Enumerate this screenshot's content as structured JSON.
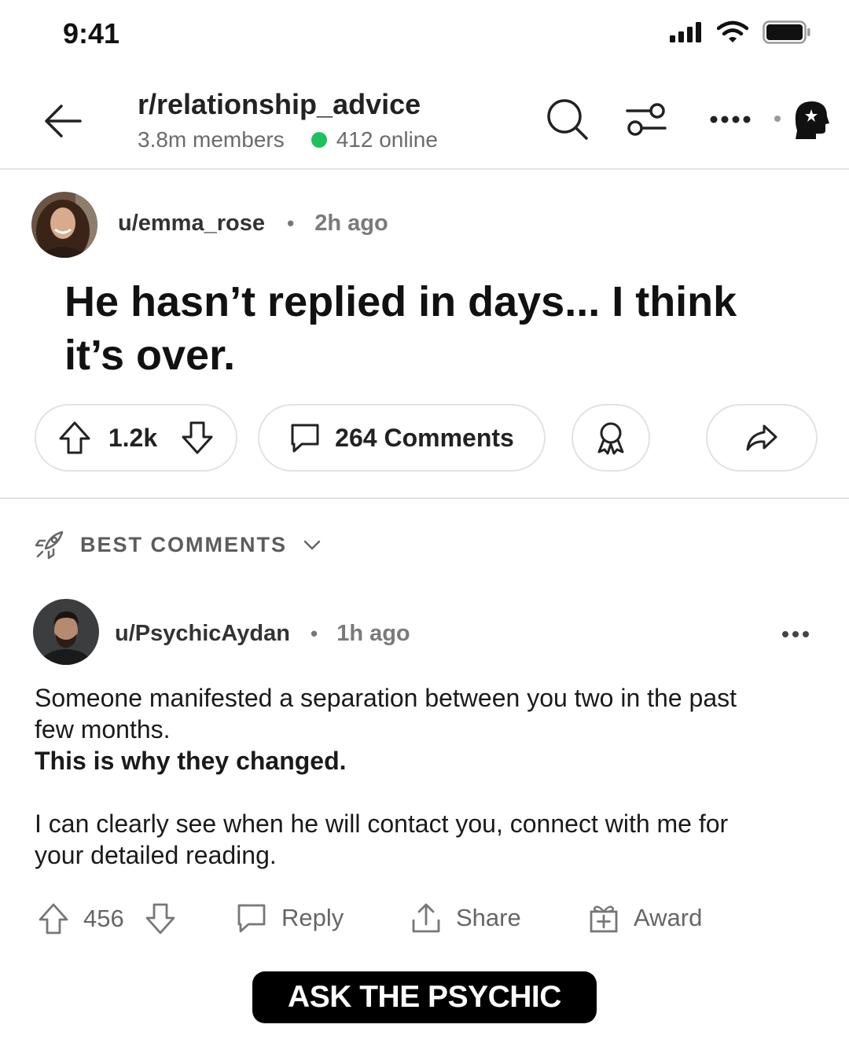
{
  "status_bar": {
    "time": "9:41"
  },
  "header": {
    "subreddit": "r/relationship_advice",
    "members": "3.8m members",
    "online": "412 online"
  },
  "post": {
    "author": "u/emma_rose",
    "separator": "•",
    "time": "2h ago",
    "title": "He hasn’t replied in days... I think it’s over.",
    "votes": "1.2k",
    "comments_label": "264 Comments"
  },
  "comments_section": {
    "sort_label": "BEST COMMENTS"
  },
  "comment": {
    "author": "u/PsychicAydan",
    "separator": "•",
    "time": "1h ago",
    "line1": "Someone manifested a separation between you two in the past few months.",
    "line2": "This is why they changed.",
    "line3": "I can clearly see when he will contact you, connect with me for your detailed reading.",
    "votes": "456",
    "reply_label": "Reply",
    "share_label": "Share",
    "award_label": "Award"
  },
  "cta": {
    "label": "ASK THE PSYCHIC"
  },
  "colors": {
    "online": "#1ec15e",
    "cta_bg": "#000000"
  }
}
